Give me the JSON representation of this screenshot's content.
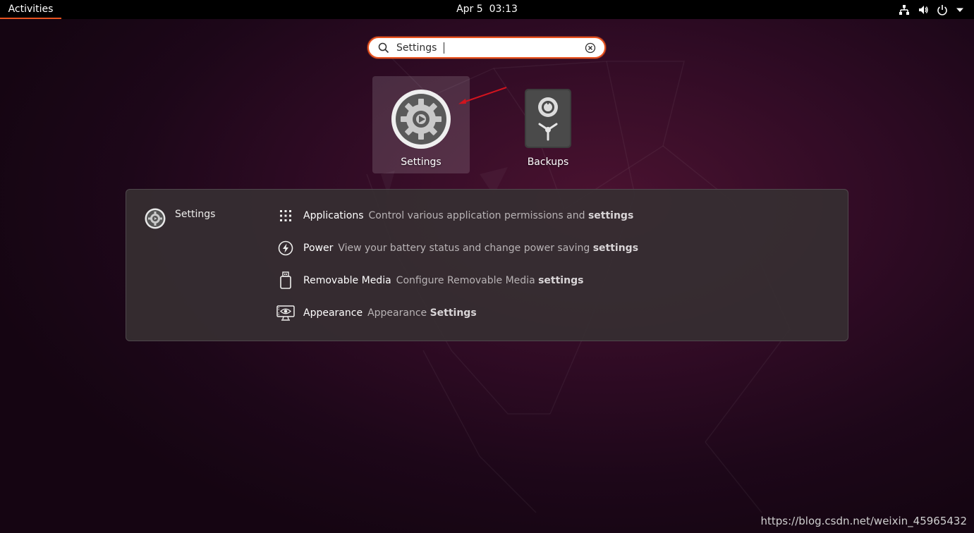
{
  "topbar": {
    "activities_label": "Activities",
    "clock_date": "Apr 5",
    "clock_time": "03:13",
    "tray_icons": [
      "network-icon",
      "volume-icon",
      "power-icon",
      "chevron-down-icon"
    ]
  },
  "search": {
    "value": "Settings",
    "icons": [
      "search-icon",
      "clear-icon"
    ]
  },
  "apps": [
    {
      "label": "Settings",
      "icon": "settings-gear-icon",
      "selected": true
    },
    {
      "label": "Backups",
      "icon": "backups-safe-icon",
      "selected": false
    }
  ],
  "results": {
    "provider": {
      "name": "Settings",
      "icon": "settings-icon"
    },
    "items": [
      {
        "name": "Applications",
        "desc_prefix": "Control various application permissions and ",
        "desc_match": "settings",
        "icon": "applications-grid-icon"
      },
      {
        "name": "Power",
        "desc_prefix": "View your battery status and change power saving ",
        "desc_match": "settings",
        "icon": "power-icon"
      },
      {
        "name": "Removable Media",
        "desc_prefix": "Configure Removable Media ",
        "desc_match": "settings",
        "icon": "removable-media-icon"
      },
      {
        "name": "Appearance",
        "desc_prefix": "Appearance ",
        "desc_match": "Settings",
        "icon": "appearance-icon"
      }
    ]
  },
  "watermark": "https://blog.csdn.net/weixin_45965432",
  "colors": {
    "accent": "#e95420",
    "topbar_bg": "#000000",
    "panel_bg": "#362e32"
  }
}
